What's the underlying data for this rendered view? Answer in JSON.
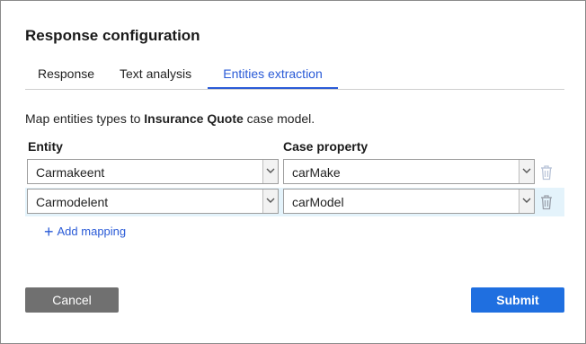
{
  "dialog": {
    "title": "Response configuration",
    "tabs": [
      {
        "label": "Response",
        "active": false
      },
      {
        "label": "Text analysis",
        "active": false
      },
      {
        "label": "Entities extraction",
        "active": true
      }
    ],
    "description_prefix": "Map entities types to ",
    "description_bold": "Insurance Quote",
    "description_suffix": " case model.",
    "columns": {
      "entity": "Entity",
      "case_property": "Case property"
    },
    "mappings": [
      {
        "entity": "Carmakeent",
        "property": "carMake",
        "highlighted": false
      },
      {
        "entity": "Carmodelent",
        "property": "carModel",
        "highlighted": true
      }
    ],
    "add_mapping_label": "Add mapping",
    "cancel_label": "Cancel",
    "submit_label": "Submit",
    "colors": {
      "accent": "#2a5bd7",
      "submit": "#1f6fe0",
      "cancel": "#707070",
      "row_highlight": "#e4f3fb"
    },
    "icons": {
      "dropdown": "chevron-down-icon",
      "delete": "trash-icon",
      "add": "plus-icon"
    }
  }
}
